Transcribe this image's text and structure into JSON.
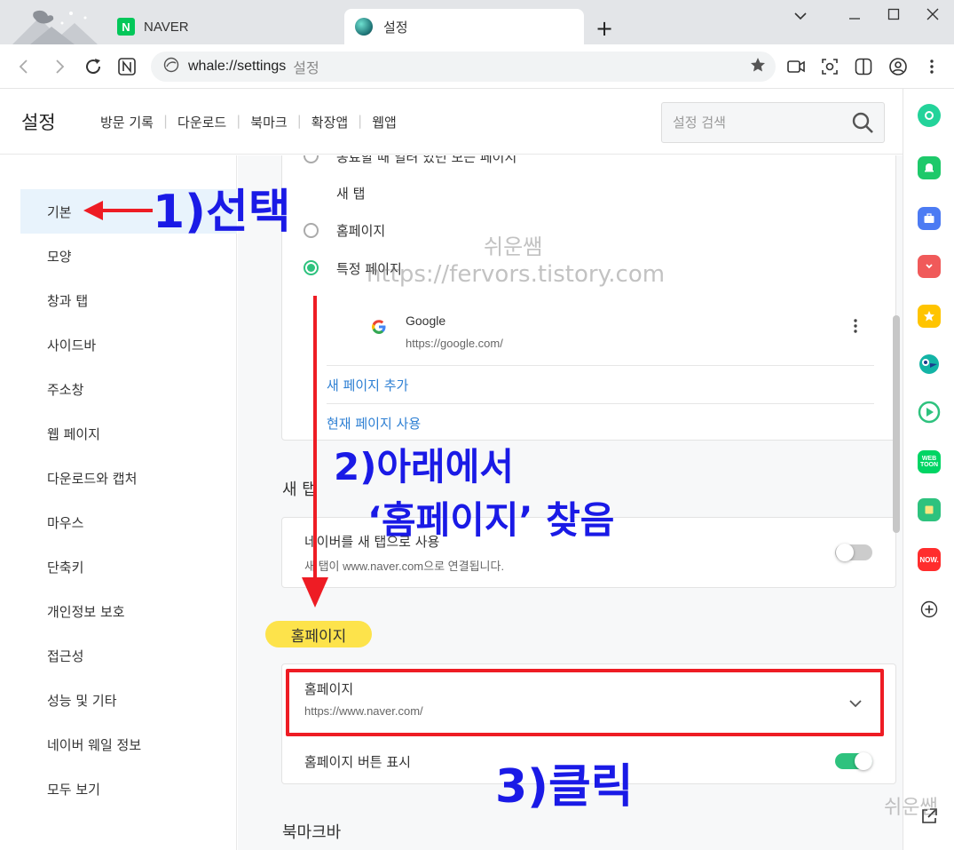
{
  "browser": {
    "tabs": [
      {
        "label": "NAVER",
        "favicon": "naver-n-icon"
      },
      {
        "label": "설정",
        "favicon": "whale-settings-icon"
      }
    ],
    "newtab_symbol": "+",
    "window_controls": [
      "⌄",
      "—",
      "☐",
      "✕"
    ],
    "address": {
      "url": "whale://settings",
      "title": "설정"
    }
  },
  "settings_header": {
    "title": "설정",
    "nav": [
      "방문 기록",
      "다운로드",
      "북마크",
      "확장앱",
      "웹앱"
    ],
    "search_placeholder": "설정 검색"
  },
  "left_nav": {
    "selected": "기본",
    "items": [
      "기본",
      "모양",
      "창과 탭",
      "사이드바",
      "주소창",
      "웹 페이지",
      "다운로드와 캡처",
      "마우스",
      "단축키",
      "개인정보 보호",
      "접근성",
      "성능 및 기타",
      "네이버 웨일 정보",
      "모두 보기"
    ]
  },
  "startup_card": {
    "options": [
      "종료할 때 열려 있던 모든 페이지",
      "새 탭",
      "홈페이지",
      "특정 페이지"
    ],
    "selected": "특정 페이지",
    "site": {
      "name": "Google",
      "url": "https://google.com/"
    },
    "add_page": "새 페이지 추가",
    "use_current": "현재 페이지 사용"
  },
  "new_tab_section": {
    "title": "새 탭",
    "option_label": "네이버를 새 탭으로 사용",
    "option_desc": "새 탭이 www.naver.com으로 연결됩니다.",
    "enabled": false
  },
  "homepage_section": {
    "title": "홈페이지",
    "dropdown_label": "홈페이지",
    "dropdown_value": "https://www.naver.com/",
    "show_button_label": "홈페이지 버튼 표시",
    "show_button_enabled": true
  },
  "bookmark_section": {
    "title": "북마크바"
  },
  "annotations": {
    "step1": "1)선택",
    "step2_line1": "2)아래에서",
    "step2_line2": "‘홈페이지’ 찾음",
    "step3": "3)클릭",
    "watermark_name": "쉬운쌤",
    "watermark_url": "https://fervors.tistory.com",
    "watermark_corner": "쉬운쌤"
  },
  "colors": {
    "accent_green": "#2ec27e",
    "annotation_blue": "#1a1ae6",
    "annotation_red": "#ee1c24",
    "highlight_yellow": "#fde34b",
    "link_blue": "#2d7fd3"
  },
  "sidebar_icons": [
    "whale-space-icon",
    "alarm-icon",
    "toolbox-icon",
    "pocket-icon",
    "favorites-star-icon",
    "papago-icon",
    "play-icon",
    "webtoon-icon",
    "memo-icon",
    "now-icon",
    "add-icon"
  ]
}
